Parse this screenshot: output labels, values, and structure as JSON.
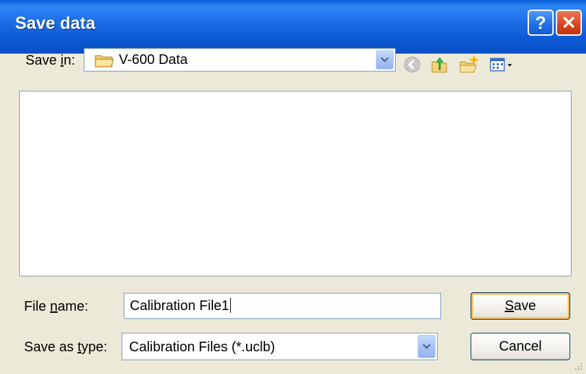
{
  "window": {
    "title": "Save data",
    "help_label": "?",
    "close_label": "✕"
  },
  "save_in": {
    "label_prefix": "Save ",
    "label_accel": "i",
    "label_suffix": "n:",
    "value": "V-600 Data"
  },
  "toolbar": {
    "icons": [
      "back-icon",
      "up-folder-icon",
      "new-folder-icon",
      "views-menu-icon"
    ]
  },
  "file_name": {
    "label_prefix": "File ",
    "label_accel": "n",
    "label_suffix": "ame:",
    "value": "Calibration File1"
  },
  "save_as_type": {
    "label_prefix": "Save as ",
    "label_accel": "t",
    "label_suffix": "ype:",
    "value": "Calibration Files (*.uclb)"
  },
  "buttons": {
    "save_accel": "S",
    "save_rest": "ave",
    "cancel": "Cancel"
  },
  "colors": {
    "title_bar": "#0a5fd8",
    "close_button": "#d8431f",
    "dialog_bg": "#ece9d8",
    "default_button_glow": "#f2b54f"
  }
}
